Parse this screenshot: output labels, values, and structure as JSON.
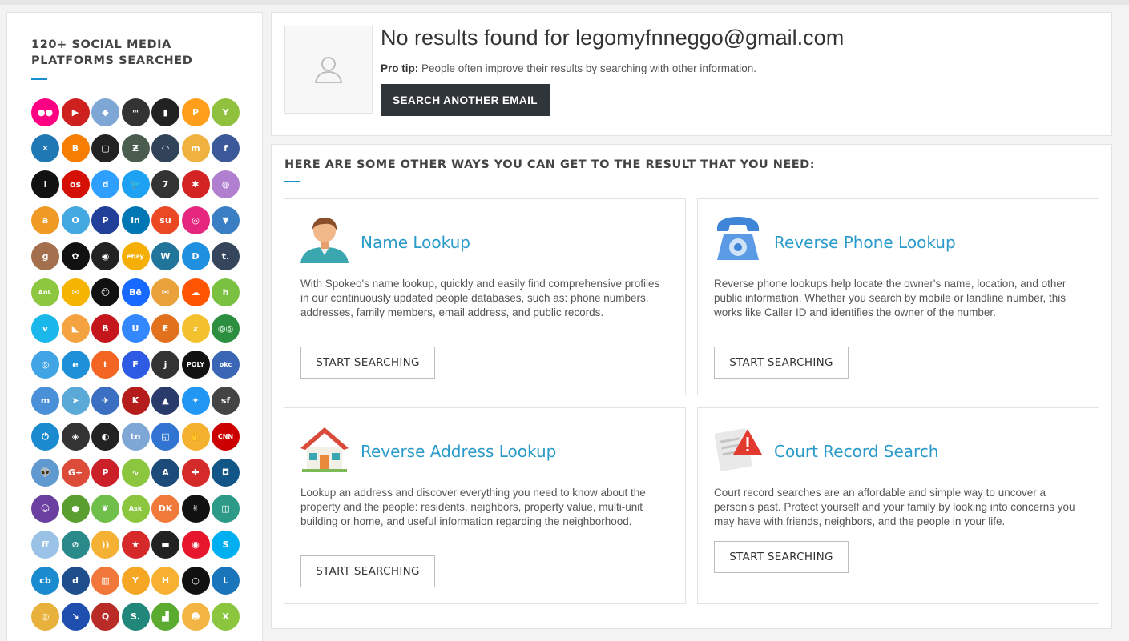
{
  "sidebar": {
    "title": "120+ SOCIAL MEDIA PLATFORMS SEARCHED",
    "icons": [
      {
        "name": "flickr-icon",
        "color": "#ff0084",
        "glyph": "●●"
      },
      {
        "name": "youtube-icon",
        "color": "#cd201f",
        "glyph": "▶"
      },
      {
        "name": "foursquare-icon",
        "color": "#7fa7d6",
        "glyph": "◆"
      },
      {
        "name": "myspace-icon",
        "color": "#333333",
        "glyph": "ᵐ"
      },
      {
        "name": "photobucket-icon",
        "color": "#222222",
        "glyph": "▮"
      },
      {
        "name": "path-icon",
        "color": "#ff9e1b",
        "glyph": "P"
      },
      {
        "name": "yahoo-answers-icon",
        "color": "#8fc13e",
        "glyph": "Y"
      },
      {
        "name": "kik-icon",
        "color": "#1f78b4",
        "glyph": "✕"
      },
      {
        "name": "blogger-icon",
        "color": "#f57d00",
        "glyph": "B"
      },
      {
        "name": "squarespace-icon",
        "color": "#222222",
        "glyph": "▢"
      },
      {
        "name": "deviantart-icon",
        "color": "#4a5d4e",
        "glyph": "Ƶ"
      },
      {
        "name": "mixcloud-icon",
        "color": "#314359",
        "glyph": "◠"
      },
      {
        "name": "meetup-icon",
        "color": "#f0b23f",
        "glyph": "m"
      },
      {
        "name": "facebook-icon",
        "color": "#3b5998",
        "glyph": "f"
      },
      {
        "name": "instapaper-icon",
        "color": "#111111",
        "glyph": "i"
      },
      {
        "name": "lastfm-icon",
        "color": "#d51007",
        "glyph": "os"
      },
      {
        "name": "disqus-icon",
        "color": "#2e9fff",
        "glyph": "d"
      },
      {
        "name": "twitter-icon",
        "color": "#1da1f2",
        "glyph": "🐦"
      },
      {
        "name": "gitlab-icon",
        "color": "#333333",
        "glyph": "7"
      },
      {
        "name": "yelp-icon",
        "color": "#d32323",
        "glyph": "✱"
      },
      {
        "name": "dribbble-icon",
        "color": "#b07fd0",
        "glyph": "◍"
      },
      {
        "name": "amazon-icon",
        "color": "#f09a26",
        "glyph": "a"
      },
      {
        "name": "orkut-icon",
        "color": "#44a9e0",
        "glyph": "O"
      },
      {
        "name": "pandora-icon",
        "color": "#224099",
        "glyph": "P"
      },
      {
        "name": "linkedin-icon",
        "color": "#0077b5",
        "glyph": "in"
      },
      {
        "name": "stumbleupon-icon",
        "color": "#eb4924",
        "glyph": "su"
      },
      {
        "name": "instagram-old-icon",
        "color": "#e4267f",
        "glyph": "◎"
      },
      {
        "name": "cup-icon",
        "color": "#3a7ec4",
        "glyph": "▼"
      },
      {
        "name": "goodreads-icon",
        "color": "#a36f4d",
        "glyph": "g"
      },
      {
        "name": "openai-icon",
        "color": "#111111",
        "glyph": "✿"
      },
      {
        "name": "wink-icon",
        "color": "#222222",
        "glyph": "◉"
      },
      {
        "name": "ebay-icon",
        "color": "#f5af02",
        "glyph": "ebay"
      },
      {
        "name": "wordpress-icon",
        "color": "#21759b",
        "glyph": "W"
      },
      {
        "name": "dailymotion-icon",
        "color": "#1f8fe0",
        "glyph": "D"
      },
      {
        "name": "tumblr-icon",
        "color": "#35465c",
        "glyph": "t."
      },
      {
        "name": "aol-icon",
        "color": "#8cc73f",
        "glyph": "Aol."
      },
      {
        "name": "mail-icon",
        "color": "#f5b400",
        "glyph": "✉"
      },
      {
        "name": "smiley-icon",
        "color": "#111111",
        "glyph": "☺"
      },
      {
        "name": "behance-icon",
        "color": "#1769ff",
        "glyph": "Bē"
      },
      {
        "name": "mailbox-icon",
        "color": "#e9a23b",
        "glyph": "✉"
      },
      {
        "name": "soundcloud-icon",
        "color": "#ff5500",
        "glyph": "☁"
      },
      {
        "name": "houzz-icon",
        "color": "#7ac142",
        "glyph": "h"
      },
      {
        "name": "vimeo-icon",
        "color": "#1ab7ea",
        "glyph": "v"
      },
      {
        "name": "swift-icon",
        "color": "#f4a340",
        "glyph": "◣"
      },
      {
        "name": "badge-b-icon",
        "color": "#c4161c",
        "glyph": "B"
      },
      {
        "name": "ustream-icon",
        "color": "#3388ff",
        "glyph": "U"
      },
      {
        "name": "etsy-e-icon",
        "color": "#e2711d",
        "glyph": "E"
      },
      {
        "name": "zillow-icon",
        "color": "#f3c12e",
        "glyph": "z"
      },
      {
        "name": "tripadvisor-icon",
        "color": "#2b8f3f",
        "glyph": "◎◎"
      },
      {
        "name": "periscope-icon",
        "color": "#40a4e5",
        "glyph": "◎"
      },
      {
        "name": "etsy-icon",
        "color": "#1e90d8",
        "glyph": "e"
      },
      {
        "name": "tagged-icon",
        "color": "#f26522",
        "glyph": "t"
      },
      {
        "name": "foursquare-f-icon",
        "color": "#2d5be3",
        "glyph": "F"
      },
      {
        "name": "jimdo-icon",
        "color": "#333333",
        "glyph": "j"
      },
      {
        "name": "polyvore-icon",
        "color": "#111111",
        "glyph": "POLY"
      },
      {
        "name": "okcupid-icon",
        "color": "#3a66b5",
        "glyph": "okc"
      },
      {
        "name": "meetme-icon",
        "color": "#4a90d9",
        "glyph": "m"
      },
      {
        "name": "fishing-icon",
        "color": "#5aa9d6",
        "glyph": "➤"
      },
      {
        "name": "plane-icon",
        "color": "#3a6fc2",
        "glyph": "✈"
      },
      {
        "name": "klout-icon",
        "color": "#b51c1c",
        "glyph": "K"
      },
      {
        "name": "graduation-icon",
        "color": "#2a3a6b",
        "glyph": "▲"
      },
      {
        "name": "messenger-icon",
        "color": "#2196f3",
        "glyph": "✦"
      },
      {
        "name": "sf-icon",
        "color": "#444444",
        "glyph": "sf"
      },
      {
        "name": "power-icon",
        "color": "#1b8bd0",
        "glyph": "⏻"
      },
      {
        "name": "brain-icon",
        "color": "#333333",
        "glyph": "◈"
      },
      {
        "name": "github-icon",
        "color": "#222222",
        "glyph": "◐"
      },
      {
        "name": "tn-icon",
        "color": "#7fa7d6",
        "glyph": "tn"
      },
      {
        "name": "delicious-icon",
        "color": "#3274d1",
        "glyph": "◱"
      },
      {
        "name": "mitten-icon",
        "color": "#f4b12d",
        "glyph": "✋"
      },
      {
        "name": "cnn-icon",
        "color": "#cc0000",
        "glyph": "CNN"
      },
      {
        "name": "reddit-icon",
        "color": "#5f99cf",
        "glyph": "👽"
      },
      {
        "name": "google-plus-icon",
        "color": "#dd4b39",
        "glyph": "G+"
      },
      {
        "name": "pinterest-icon",
        "color": "#cb2027",
        "glyph": "P"
      },
      {
        "name": "ustream-wave-icon",
        "color": "#8cc63f",
        "glyph": "∿"
      },
      {
        "name": "appstore-icon",
        "color": "#1c4b7a",
        "glyph": "A"
      },
      {
        "name": "lifebuoy-icon",
        "color": "#d42a2a",
        "glyph": "✚"
      },
      {
        "name": "instagram-icon",
        "color": "#125688",
        "glyph": "◘"
      },
      {
        "name": "yahoo-smile-icon",
        "color": "#6b3fa0",
        "glyph": "☺"
      },
      {
        "name": "hangouts-icon",
        "color": "#5a9e2f",
        "glyph": "●"
      },
      {
        "name": "bird-icon",
        "color": "#6fbf4a",
        "glyph": "❦"
      },
      {
        "name": "ask-icon",
        "color": "#8cc63f",
        "glyph": "Ask"
      },
      {
        "name": "dk-icon",
        "color": "#f07a3a",
        "glyph": "DK"
      },
      {
        "name": "peace-icon",
        "color": "#111111",
        "glyph": "✌"
      },
      {
        "name": "profile-card-icon",
        "color": "#2c9a86",
        "glyph": "◫"
      },
      {
        "name": "ff-icon",
        "color": "#9ac2e6",
        "glyph": "ff"
      },
      {
        "name": "compass-icon",
        "color": "#2a8a8a",
        "glyph": "⊘"
      },
      {
        "name": "rss-icon",
        "color": "#f5b133",
        "glyph": "))"
      },
      {
        "name": "star-icon",
        "color": "#d62a2a",
        "glyph": "★"
      },
      {
        "name": "minus-icon",
        "color": "#222222",
        "glyph": "▬"
      },
      {
        "name": "weibo-icon",
        "color": "#e6162d",
        "glyph": "◉"
      },
      {
        "name": "skype-icon",
        "color": "#00aff0",
        "glyph": "S"
      },
      {
        "name": "cb-icon",
        "color": "#1b8bd0",
        "glyph": "cb"
      },
      {
        "name": "dailybooth-icon",
        "color": "#1f4e8c",
        "glyph": "d"
      },
      {
        "name": "popcorn-icon",
        "color": "#f2773b",
        "glyph": "▥"
      },
      {
        "name": "yahoo-y-icon",
        "color": "#f5a623",
        "glyph": "Y"
      },
      {
        "name": "hackernews-icon",
        "color": "#f8b133",
        "glyph": "H"
      },
      {
        "name": "circle-o-icon",
        "color": "#111111",
        "glyph": "○"
      },
      {
        "name": "livejournal-icon",
        "color": "#1a75bb",
        "glyph": "L"
      },
      {
        "name": "yb-icon",
        "color": "#e8b13c",
        "glyph": "◎"
      },
      {
        "name": "pocket-arrow-icon",
        "color": "#1f4fae",
        "glyph": "↘"
      },
      {
        "name": "quora-icon",
        "color": "#b92b27",
        "glyph": "Q"
      },
      {
        "name": "skillshare-icon",
        "color": "#21877a",
        "glyph": "S."
      },
      {
        "name": "vine-chart-icon",
        "color": "#5aab2f",
        "glyph": "▟"
      },
      {
        "name": "face-icon",
        "color": "#f2b443",
        "glyph": "☻"
      },
      {
        "name": "xing-icon",
        "color": "#8cc63f",
        "glyph": "X"
      }
    ]
  },
  "result": {
    "title": "No results found for legomyfnneggo@gmail.com",
    "protip_label": "Pro tip:",
    "protip_text": " People often improve their results by searching with other information.",
    "button_label": "SEARCH ANOTHER EMAIL"
  },
  "ways": {
    "title": "HERE ARE SOME OTHER WAYS YOU CAN GET TO THE RESULT THAT YOU NEED:",
    "cards": [
      {
        "title": "Name Lookup",
        "icon": "person-icon",
        "description": "With Spokeo's name lookup, quickly and easily find comprehensive profiles in our continuously updated people databases, such as: phone numbers, addresses, family members, email address, and public records.",
        "button": "START SEARCHING"
      },
      {
        "title": "Reverse Phone Lookup",
        "icon": "telephone-icon",
        "description": "Reverse phone lookups help locate the owner's name, location, and other public information. Whether you search by mobile or landline number, this works like Caller ID and identifies the owner of the number.",
        "button": "START SEARCHING"
      },
      {
        "title": "Reverse Address Lookup",
        "icon": "house-icon",
        "description": "Lookup an address and discover everything you need to know about the property and the people: residents, neighbors, property value, multi-unit building or home, and useful information regarding the neighborhood.",
        "button": "START SEARCHING"
      },
      {
        "title": "Court Record Search",
        "icon": "court-document-warning-icon",
        "description": "Court record searches are an affordable and simple way to uncover a person's past. Protect yourself and your family by looking into concerns you may have with friends, neighbors, and the people in your life.",
        "button": "START SEARCHING"
      }
    ]
  }
}
